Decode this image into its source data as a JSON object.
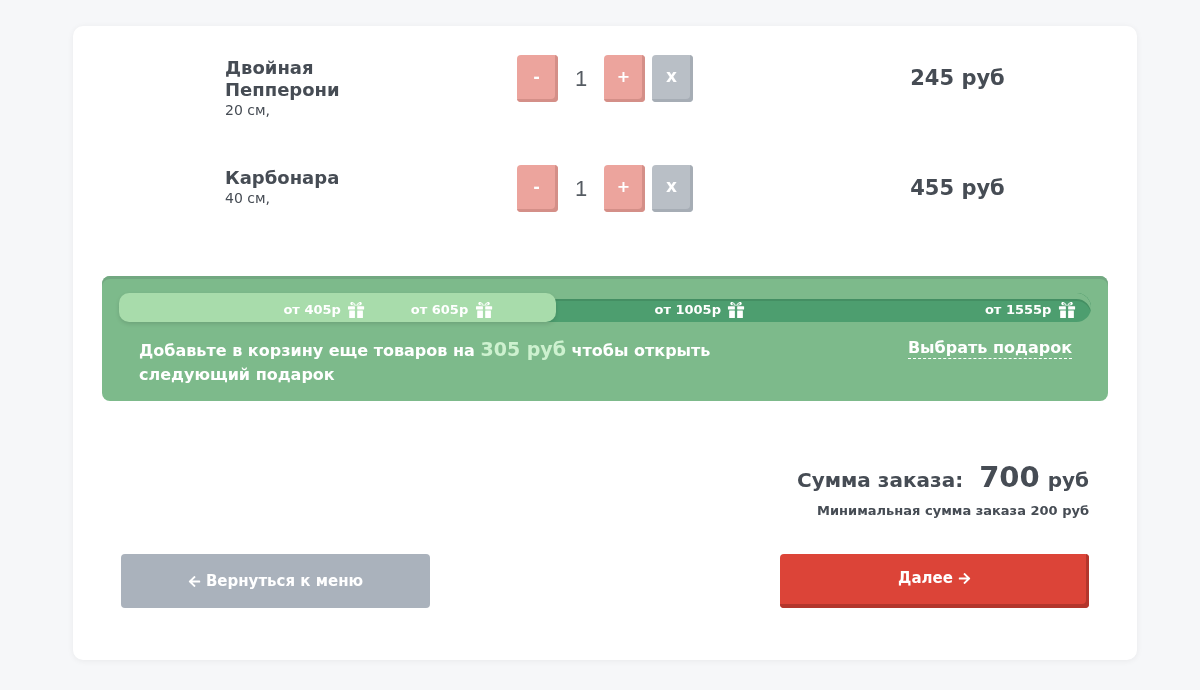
{
  "cart_items": [
    {
      "name": "Двойная Пепперони",
      "size": "20 см,",
      "decrease_label": "-",
      "quantity": "1",
      "increase_label": "+",
      "remove_label": "x",
      "price": "245 руб"
    },
    {
      "name": "Карбонара",
      "size": "40 см,",
      "decrease_label": "-",
      "quantity": "1",
      "increase_label": "+",
      "remove_label": "x",
      "price": "455 руб"
    }
  ],
  "gift_progress": {
    "level": 0.45,
    "milestones": [
      {
        "label": "от 405р"
      },
      {
        "label": "от 605р"
      },
      {
        "label": "от 1005р"
      },
      {
        "label": "от 1555р"
      }
    ],
    "message": {
      "before": "Добавьте в корзину еще товаров на",
      "amount": "305 руб",
      "after": "чтобы открыть следующий подарок"
    },
    "link": "Выбрать подарок"
  },
  "order_summary": {
    "label": "Сумма заказа:",
    "amount": "700",
    "currency": "руб",
    "minimum_note": "Минимальная сумма заказа 200 руб"
  },
  "actions": {
    "back": "Вернуться к меню",
    "next": "Далее"
  }
}
